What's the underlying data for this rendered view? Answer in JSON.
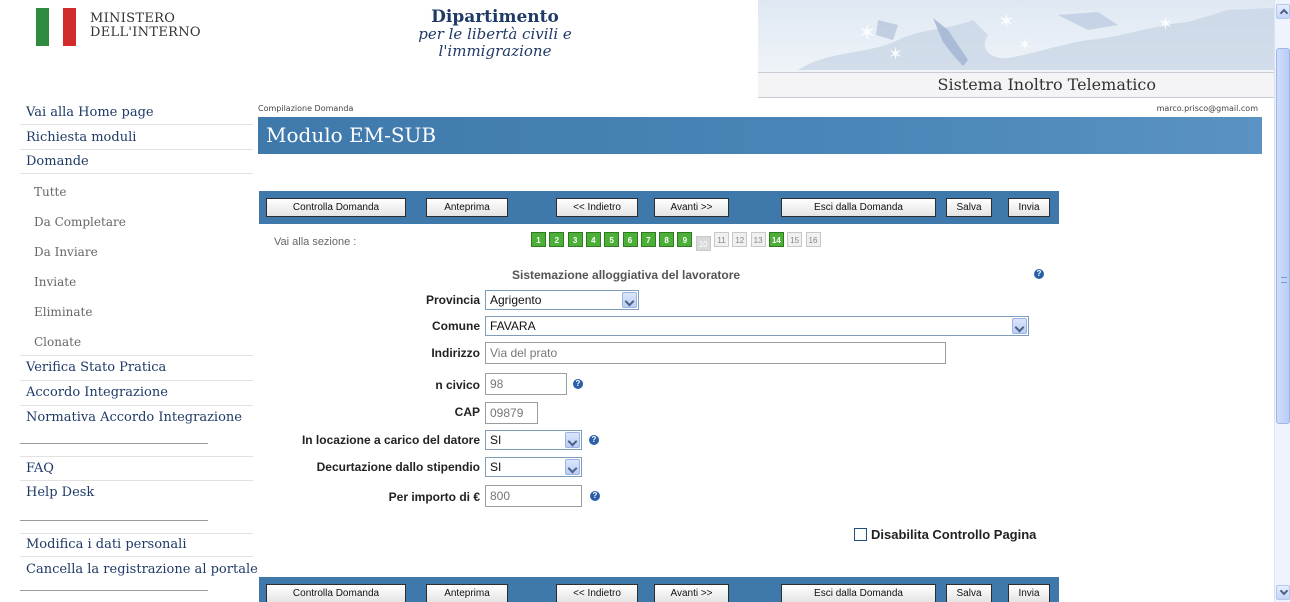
{
  "header": {
    "ministry_line1": "MINISTERO",
    "ministry_line2": "DELL'INTERNO",
    "dept_line1": "Dipartimento",
    "dept_line2": "per le libertà civili e",
    "dept_line3": "l'immigrazione",
    "system_title": "Sistema Inoltro Telematico"
  },
  "nav": {
    "home": "Vai alla Home page",
    "richiesta_moduli": "Richiesta moduli",
    "domande": "Domande",
    "tutte": "Tutte",
    "da_completare": "Da Completare",
    "da_inviare": "Da Inviare",
    "inviate": "Inviate",
    "eliminate": "Eliminate",
    "clonate": "Clonate",
    "verifica": "Verifica Stato Pratica",
    "accordo": "Accordo Integrazione",
    "normativa": "Normativa Accordo Integrazione",
    "faq": "FAQ",
    "helpdesk": "Help Desk",
    "modifica": "Modifica i dati personali",
    "cancella": "Cancella la registrazione al portale"
  },
  "breadcrumb": "Compilazione Domanda",
  "user_email": "marco.prisco@gmail.com",
  "page_title": "Modulo EM-SUB",
  "toolbar": {
    "controlla": "Controlla Domanda",
    "anteprima": "Anteprima",
    "indietro": "<< Indietro",
    "avanti": "Avanti >>",
    "esci": "Esci dalla Domanda",
    "salva": "Salva",
    "invia": "Invia"
  },
  "sections": {
    "label": "Vai alla sezione :",
    "steps": [
      "1",
      "2",
      "3",
      "4",
      "5",
      "6",
      "7",
      "8",
      "9",
      "10",
      "11",
      "12",
      "13",
      "14",
      "15",
      "16"
    ],
    "completed": [
      1,
      2,
      3,
      4,
      5,
      6,
      7,
      8,
      9,
      14
    ],
    "current": 10
  },
  "form": {
    "section_title": "Sistemazione alloggiativa del lavoratore",
    "provincia_label": "Provincia",
    "provincia_value": "Agrigento",
    "comune_label": "Comune",
    "comune_value": "FAVARA",
    "indirizzo_label": "Indirizzo",
    "indirizzo_value": "Via del prato",
    "civico_label": "n civico",
    "civico_value": "98",
    "cap_label": "CAP",
    "cap_value": "09879",
    "locazione_label": "In locazione a carico del datore",
    "locazione_value": "SI",
    "decurtazione_label": "Decurtazione dallo stipendio",
    "decurtazione_value": "SI",
    "importo_label": "Per importo di €",
    "importo_value": "800",
    "disable_check_label": "Disabilita Controllo Pagina"
  },
  "icons": {
    "help": "help-icon",
    "dropdown": "chevron-down-icon"
  },
  "colors": {
    "banner_blue": "#3f79ab",
    "step_green": "#4caf37",
    "nav_link": "#1f3a66"
  }
}
